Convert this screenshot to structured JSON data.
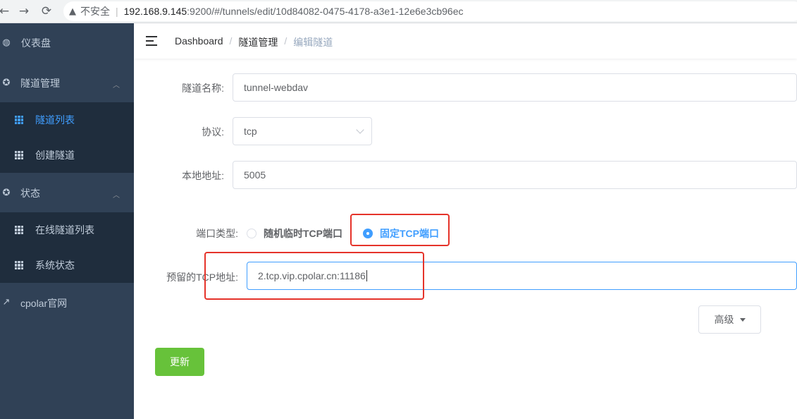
{
  "browser": {
    "back_icon": "arrow-left-icon",
    "insecure_label": "不安全",
    "url_host": "192.168.9.145",
    "url_rest": ":9200/#/tunnels/edit/10d84082-0475-4178-a3e1-12e6e3cb96ec"
  },
  "sidebar": {
    "dashboard": "仪表盘",
    "tunnel_mgmt": "隧道管理",
    "tunnel_list": "隧道列表",
    "create_tunnel": "创建隧道",
    "status": "状态",
    "online_tunnels": "在线隧道列表",
    "system_status": "系统状态",
    "cpolar_site": "cpolar官网"
  },
  "breadcrumb": {
    "home": "Dashboard",
    "section": "隧道管理",
    "current": "编辑隧道",
    "separator": "/"
  },
  "form": {
    "name_label": "隧道名称:",
    "name_value": "tunnel-webdav",
    "protocol_label": "协议:",
    "protocol_value": "tcp",
    "local_label": "本地地址:",
    "local_value": "5005",
    "port_type_label": "端口类型:",
    "port_random": "随机临时TCP端口",
    "port_fixed": "固定TCP端口",
    "reserved_label": "预留的TCP地址:",
    "reserved_value": "2.tcp.vip.cpolar.cn:11186",
    "advanced_button": "高级",
    "update_button": "更新"
  },
  "colors": {
    "sidebar_bg": "#304156",
    "submenu_bg": "#1f2d3d",
    "active": "#409eff",
    "update_button": "#67c23a",
    "highlight_box": "#e5332a"
  }
}
